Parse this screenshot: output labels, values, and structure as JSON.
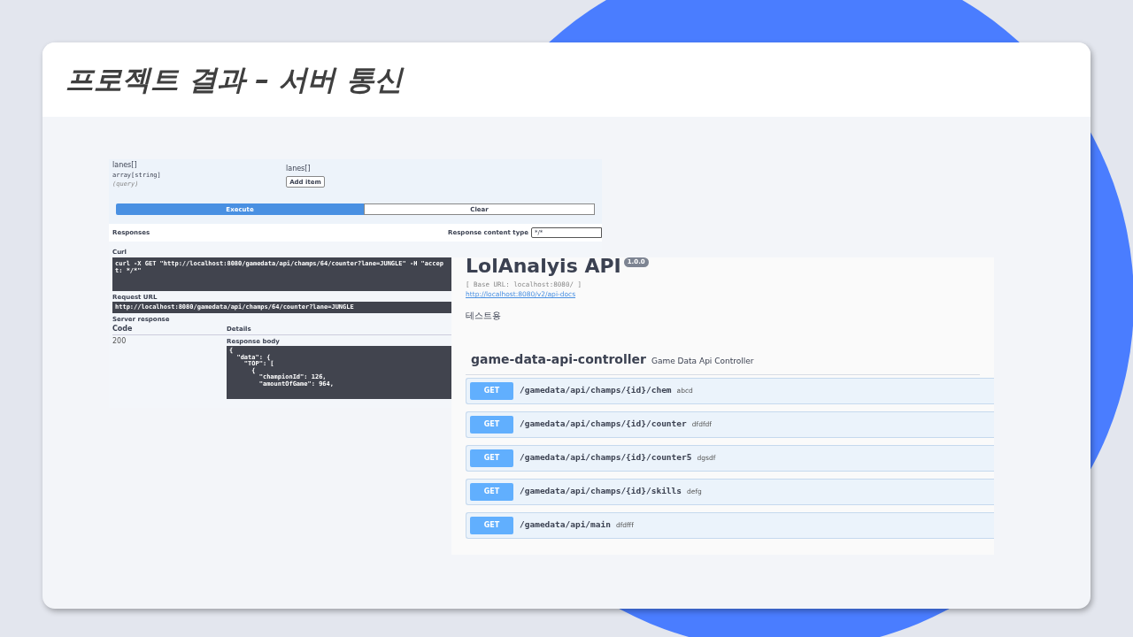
{
  "slide": {
    "title": "프로젝트 결과 – 서버 통신"
  },
  "request_panel": {
    "param": {
      "name": "lanes[]",
      "type": "array[string]",
      "location": "(query)",
      "field_label": "lanes[]",
      "add_button": "Add item"
    },
    "execute_button": "Execute",
    "clear_button": "Clear",
    "responses_heading": "Responses",
    "content_type_label": "Response content type",
    "content_type_value": "*/*",
    "curl_label": "Curl",
    "curl_command": "curl -X GET \"http://localhost:8080/gamedata/api/champs/64/counter?lane=JUNGLE\" -H \"accept: */*\"",
    "request_url_label": "Request URL",
    "request_url": "http://localhost:8080/gamedata/api/champs/64/counter?lane=JUNGLE",
    "server_response_label": "Server response",
    "columns": [
      "Code",
      "Details"
    ],
    "code": "200",
    "response_body_label": "Response body",
    "response_body_lines": [
      "{",
      "  \"data\": {",
      "    \"TOP\": [",
      "      {",
      "        \"championId\": 126,",
      "        \"amountOfGame\": 964,"
    ]
  },
  "api_doc": {
    "title": "LolAnalyis API",
    "version": "1.0.0",
    "base_url": "[ Base URL: localhost:8080/ ]",
    "docs_link": "http://localhost:8080/v2/api-docs",
    "description": "테스트용",
    "tag": {
      "name": "game-data-api-controller",
      "description": "Game Data Api Controller"
    },
    "operations": [
      {
        "method": "GET",
        "path": "/gamedata/api/champs/{id}/chem",
        "summary": "abcd"
      },
      {
        "method": "GET",
        "path": "/gamedata/api/champs/{id}/counter",
        "summary": "dfdfdf"
      },
      {
        "method": "GET",
        "path": "/gamedata/api/champs/{id}/counter5",
        "summary": "dgsdf"
      },
      {
        "method": "GET",
        "path": "/gamedata/api/champs/{id}/skills",
        "summary": "defg"
      },
      {
        "method": "GET",
        "path": "/gamedata/api/main",
        "summary": "dfdfff"
      }
    ]
  }
}
